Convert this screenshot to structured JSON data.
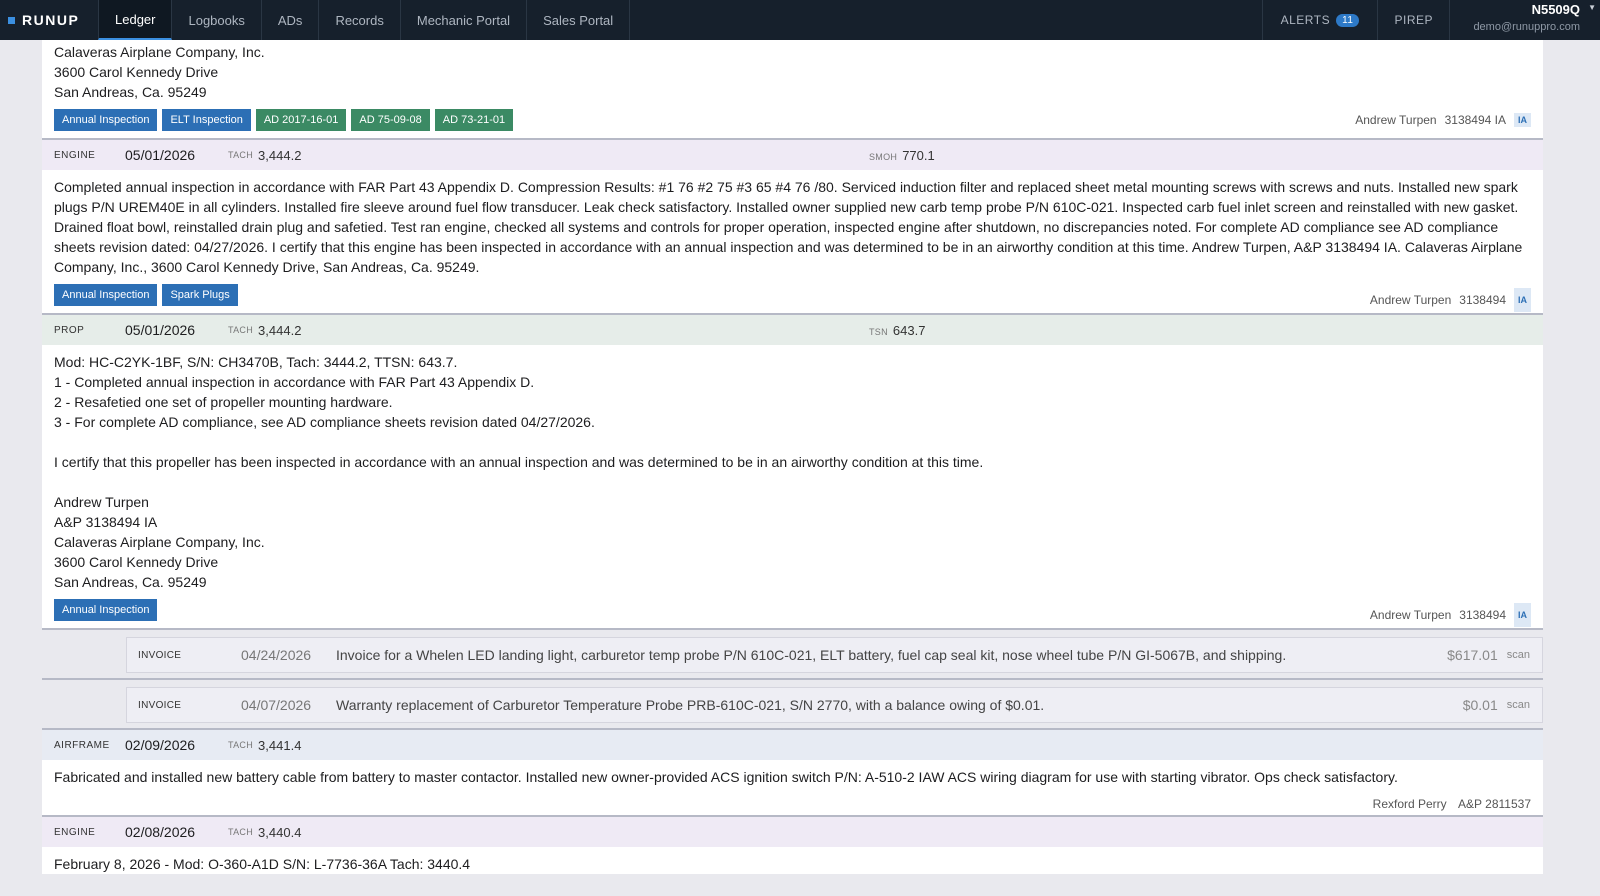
{
  "nav": {
    "brand": "RUNUP",
    "tabs": [
      "Ledger",
      "Logbooks",
      "ADs",
      "Records",
      "Mechanic Portal",
      "Sales Portal"
    ],
    "alerts_label": "ALERTS",
    "alerts_count": "11",
    "pirep_label": "PIREP",
    "tail_number": "N5509Q",
    "email": "demo@runuppro.com"
  },
  "top_entry": {
    "address": [
      "Calaveras Airplane Company, Inc.",
      "3600 Carol Kennedy Drive",
      "San Andreas, Ca. 95249"
    ],
    "tags": [
      {
        "label": "Annual Inspection",
        "color": "#2c6fb5"
      },
      {
        "label": "ELT Inspection",
        "color": "#2c6fb5"
      },
      {
        "label": "AD 2017-16-01",
        "color": "#3b8a64"
      },
      {
        "label": "AD 75-09-08",
        "color": "#3b8a64"
      },
      {
        "label": "AD 73-21-01",
        "color": "#3b8a64"
      }
    ],
    "signer": "Andrew Turpen",
    "cert": "3138494 IA",
    "badge": "IA"
  },
  "engine_entry": {
    "type": "ENGINE",
    "date": "05/01/2026",
    "m1_label": "TACH",
    "m1_value": "3,444.2",
    "m2_label": "SMOH",
    "m2_value": "770.1",
    "body": "Completed annual inspection in accordance with FAR Part 43 Appendix D. Compression Results: #1 76 #2 75 #3 65 #4 76 /80. Serviced induction filter and replaced sheet metal mounting screws with screws and nuts. Installed new spark plugs P/N UREM40E in all cylinders. Installed fire sleeve around fuel flow transducer. Leak check satisfactory. Installed owner supplied new carb temp probe P/N 610C-021. Inspected carb fuel inlet screen and reinstalled with new gasket. Drained float bowl, reinstalled drain plug and safetied. Test ran engine, checked all systems and controls for proper operation, inspected engine after shutdown, no discrepancies noted. For complete AD compliance see AD compliance sheets revision dated: 04/27/2026. I certify that this engine has been inspected in accordance with an annual inspection and was determined to be in an airworthy condition at this time. Andrew Turpen, A&P 3138494 IA. Calaveras Airplane Company, Inc., 3600 Carol Kennedy Drive, San Andreas, Ca. 95249.",
    "tags": [
      {
        "label": "Annual Inspection",
        "color": "#2c6fb5"
      },
      {
        "label": "Spark Plugs",
        "color": "#2c6fb5"
      }
    ],
    "signer": "Andrew Turpen",
    "cert": "3138494",
    "badge": "IA"
  },
  "prop_entry": {
    "type": "PROP",
    "date": "05/01/2026",
    "m1_label": "TACH",
    "m1_value": "3,444.2",
    "m2_label": "TSN",
    "m2_value": "643.7",
    "lines": [
      "Mod: HC-C2YK-1BF, S/N: CH3470B, Tach: 3444.2, TTSN: 643.7.",
      "1 - Completed annual inspection in accordance with FAR Part 43 Appendix D.",
      "2 - Resafetied one set of propeller mounting hardware.",
      "3 - For complete AD compliance, see AD compliance sheets revision dated 04/27/2026.",
      "",
      "I certify that this propeller has been inspected in accordance with an annual inspection and was determined to be in an airworthy condition at this time.",
      "",
      "Andrew Turpen",
      "A&P 3138494 IA",
      "Calaveras Airplane Company, Inc.",
      "3600 Carol Kennedy Drive",
      "San Andreas, Ca. 95249"
    ],
    "tags": [
      {
        "label": "Annual Inspection",
        "color": "#2c6fb5"
      }
    ],
    "signer": "Andrew Turpen",
    "cert": "3138494",
    "badge": "IA"
  },
  "invoices": [
    {
      "type": "INVOICE",
      "date": "04/24/2026",
      "description": "Invoice for a Whelen LED landing light, carburetor temp probe P/N 610C-021, ELT battery, fuel cap seal kit, nose wheel tube P/N GI-5067B, and shipping.",
      "amount": "$617.01",
      "scan": "scan"
    },
    {
      "type": "INVOICE",
      "date": "04/07/2026",
      "description": "Warranty replacement of Carburetor Temperature Probe PRB-610C-021, S/N 2770, with a balance owing of $0.01.",
      "amount": "$0.01",
      "scan": "scan"
    }
  ],
  "airframe_entry": {
    "type": "AIRFRAME",
    "date": "02/09/2026",
    "m1_label": "TACH",
    "m1_value": "3,441.4",
    "body": "Fabricated and installed new battery cable from battery to master contactor. Installed new owner-provided ACS ignition switch P/N: A-510-2 IAW ACS wiring diagram for use with starting vibrator. Ops check satisfactory.",
    "signer": "Rexford Perry",
    "cert": "A&P 2811537"
  },
  "engine_entry_2": {
    "type": "ENGINE",
    "date": "02/08/2026",
    "m1_label": "TACH",
    "m1_value": "3,440.4",
    "body": "February 8, 2026 - Mod: O-360-A1D S/N: L-7736-36A Tach: 3440.4"
  }
}
